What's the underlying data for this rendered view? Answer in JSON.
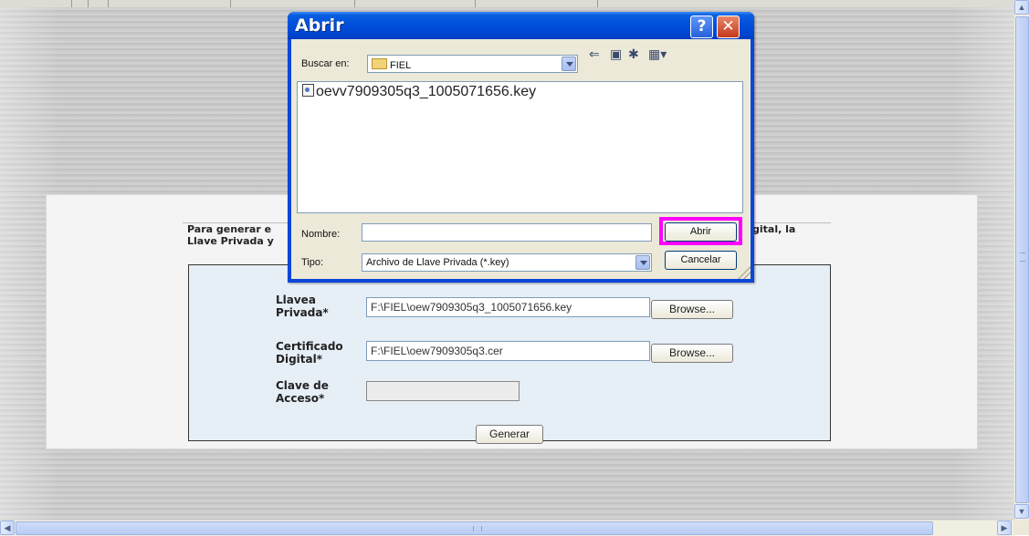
{
  "page": {
    "instructions_left": "Para generar e\nLlave Privada y",
    "instructions_right": "gital, la",
    "form": {
      "private_key_label": "Llavea\nPrivada*",
      "private_key_value": "F:\\FIEL\\oew7909305q3_1005071656.key",
      "certificate_label": "Certificado\nDigital*",
      "certificate_value": "F:\\FIEL\\oew7909305q3.cer",
      "password_label": "Clave de\nAcceso*",
      "password_value": "",
      "browse_label": "Browse...",
      "generate_label": "Generar"
    }
  },
  "dialog": {
    "title": "Abrir",
    "help_label": "?",
    "close_label": "✕",
    "look_in_label": "Buscar en:",
    "look_in_value": "FIEL",
    "files": [
      "oevv7909305q3_1005071656.key"
    ],
    "name_label": "Nombre:",
    "name_value": "",
    "type_label": "Tipo:",
    "type_value": "Archivo de Llave Privada (*.key)",
    "open_button": "Abrir",
    "cancel_button": "Cancelar",
    "highlight_color": "#ff00ff"
  },
  "colors": {
    "titlebar": "#0050dc",
    "dialog_body": "#ece9d8",
    "form_background": "#e6eef6"
  }
}
